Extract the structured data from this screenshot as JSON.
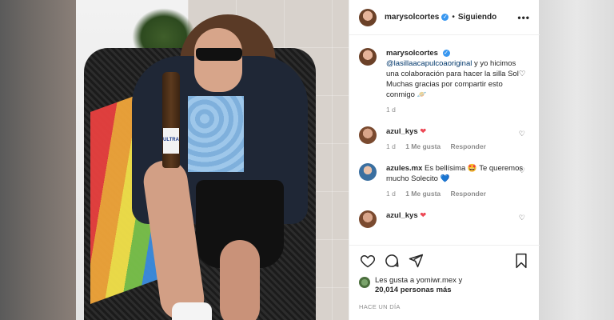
{
  "header": {
    "username": "marysolcortes",
    "following_label": "Siguiendo",
    "separator": "•",
    "more_label": "•••"
  },
  "caption": {
    "username": "marysolcortes",
    "mention": "@lasillaacapulcoaoriginal",
    "text": " y yo hicimos una colaboración para hacer la silla Sol♡",
    "text2": "Muchas gracias por compartir esto conmigo 🪐",
    "time": "1 d"
  },
  "comments": [
    {
      "username": "azul_kys",
      "text": " ❤",
      "time": "1 d",
      "likes": "1 Me gusta",
      "reply": "Responder"
    },
    {
      "username": "azules.mx",
      "text": " Es bellísima 🤩 Te queremos mucho Solecito 💙",
      "time": "1 d",
      "likes": "1 Me gusta",
      "reply": "Responder"
    },
    {
      "username": "azul_kys",
      "text": " ❤"
    }
  ],
  "likes": {
    "line1": "Les gusta a yomiwr.mex y",
    "line2": "20,014 personas más"
  },
  "posted_ago": "HACE UN DÍA",
  "photo": {
    "bottle_label": "ULTRA"
  },
  "colors": {
    "accent": "#3897f0",
    "like_red": "#ed4956",
    "muted": "#8e8e8e"
  },
  "icons": [
    "heart-icon",
    "comment-icon",
    "share-icon",
    "bookmark-icon",
    "verified-icon",
    "more-icon"
  ]
}
